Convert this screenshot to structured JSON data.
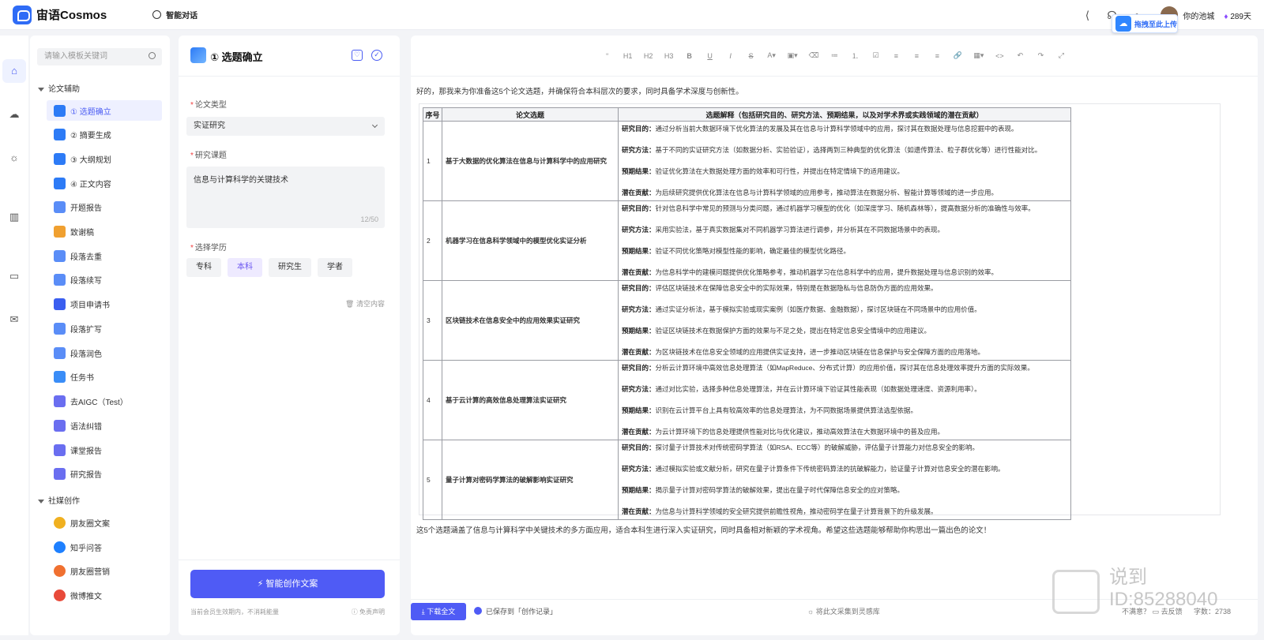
{
  "topbar": {
    "brand": "宙语Cosmos",
    "nav_label": "智能对话",
    "icons": [
      "share-icon",
      "headphones-icon",
      "bell-icon"
    ],
    "pool_label": "你的池城",
    "vip_label": "289天",
    "upload_badge": "拖拽至此上传"
  },
  "rail": {
    "items": [
      "home-icon",
      "cloud-icon",
      "bulb-icon",
      "book-icon",
      "monitor-icon",
      "inbox-icon"
    ]
  },
  "templates": {
    "search_placeholder": "请输入模板关键词",
    "groups": [
      {
        "label": "论文辅助",
        "items": [
          {
            "label": "① 选题确立",
            "active": true,
            "color": "#2d7bf6"
          },
          {
            "label": "② 摘要生成",
            "color": "#2d7bf6"
          },
          {
            "label": "③ 大纲规划",
            "color": "#2d7bf6"
          },
          {
            "label": "④ 正文内容",
            "color": "#2d7bf6"
          },
          {
            "label": "开题报告",
            "color": "#5a8df7"
          },
          {
            "label": "致谢稿",
            "color": "#f0a030"
          },
          {
            "label": "段落去重",
            "color": "#5a8df7"
          },
          {
            "label": "段落续写",
            "color": "#5a8df7"
          },
          {
            "label": "项目申请书",
            "color": "#3a5ef0"
          },
          {
            "label": "段落扩写",
            "color": "#5a8df7"
          },
          {
            "label": "段落润色",
            "color": "#5a8df7"
          },
          {
            "label": "任务书",
            "color": "#3a8df7"
          },
          {
            "label": "去AIGC（Test）",
            "color": "#6a6ef0"
          },
          {
            "label": "语法纠错",
            "color": "#6a6ef0"
          },
          {
            "label": "课堂报告",
            "color": "#6a6ef0"
          },
          {
            "label": "研究报告",
            "color": "#6a6ef0"
          }
        ]
      },
      {
        "label": "社媒创作",
        "items": [
          {
            "label": "朋友圈文案",
            "color": "#f0b020"
          },
          {
            "label": "知乎问答",
            "color": "#1e80ff"
          },
          {
            "label": "朋友圈营销",
            "color": "#f07030"
          },
          {
            "label": "微博推文",
            "color": "#e84a3a"
          }
        ]
      }
    ]
  },
  "form": {
    "title": "① 选题确立",
    "type_label": "论文类型",
    "type_value": "实证研究",
    "topic_label": "研究课题",
    "topic_value": "信息与计算科学的关键技术",
    "topic_count": "12/50",
    "edu_label": "选择学历",
    "edu_options": [
      "专科",
      "本科",
      "研究生",
      "学者"
    ],
    "edu_selected": "本科",
    "clear_label": "清空内容",
    "generate_label": "智能创作文案",
    "footer_left": "当前会员生效期内，不消耗能量",
    "footer_right": "免责声明"
  },
  "editor": {
    "toolbar": [
      "“",
      "H1",
      "H2",
      "H3",
      "B",
      "U",
      "I",
      "S",
      "A▾",
      "▣▾",
      "⌫",
      "≔",
      "⒈",
      "☑",
      "≡",
      "≡",
      "≡",
      "🔗",
      "▦▾",
      "<>",
      "↶",
      "↷",
      "⤢"
    ],
    "intro": "好的，那我来为你准备这5个论文选题，并确保符合本科层次的要求，同时具备学术深度与创新性。",
    "table_headers": [
      "序号",
      "论文选题",
      "选题解释（包括研究目的、研究方法、预期结果，以及对学术界或实践领域的潜在贡献）"
    ],
    "rows": [
      {
        "num": "1",
        "topic": "基于大数据的优化算法在信息与计算科学中的应用研究",
        "purpose": "通过分析当前大数据环境下优化算法的发展及其在信息与计算科学领域中的应用，探讨其在数据处理与信息挖掘中的表现。",
        "method": "基于不同的实证研究方法（如数据分析、实验验证），选择两到三种典型的优化算法（如遗传算法、粒子群优化等）进行性能对比。",
        "result": "验证优化算法在大数据处理方面的效率和可行性，并提出在特定情境下的适用建议。",
        "contrib": "为后续研究提供优化算法在信息与计算科学领域的应用参考，推动算法在数据分析、智能计算等领域的进一步应用。"
      },
      {
        "num": "2",
        "topic": "机器学习在信息科学领域中的模型优化实证分析",
        "purpose": "针对信息科学中常见的预测与分类问题，通过机器学习模型的优化（如深度学习、随机森林等），提高数据分析的准确性与效率。",
        "method": "采用实验法，基于真实数据集对不同机器学习算法进行调参，并分析其在不同数据场景中的表现。",
        "result": "验证不同优化策略对模型性能的影响，确定最佳的模型优化路径。",
        "contrib": "为信息科学中的建模问题提供优化策略参考，推动机器学习在信息科学中的应用，提升数据处理与信息识别的效率。"
      },
      {
        "num": "3",
        "topic": "区块链技术在信息安全中的应用效果实证研究",
        "purpose": "评估区块链技术在保障信息安全中的实际效果，特别是在数据隐私与信息防伪方面的应用效果。",
        "method": "通过实证分析法，基于模拟实验或现实案例（如医疗数据、金融数据），探讨区块链在不同场景中的应用价值。",
        "result": "验证区块链技术在数据保护方面的效果与不足之处，提出在特定信息安全情境中的应用建议。",
        "contrib": "为区块链技术在信息安全领域的应用提供实证支持，进一步推动区块链在信息保护与安全保障方面的应用落地。"
      },
      {
        "num": "4",
        "topic": "基于云计算的高效信息处理算法实证研究",
        "purpose": "分析云计算环境中高效信息处理算法（如MapReduce、分布式计算）的应用价值，探讨其在信息处理效率提升方面的实际效果。",
        "method": "通过对比实验，选择多种信息处理算法，并在云计算环境下验证其性能表现（如数据处理速度、资源利用率）。",
        "result": "识别在云计算平台上具有较高效率的信息处理算法，为不同数据场景提供算法选型依据。",
        "contrib": "为云计算环境下的信息处理提供性能对比与优化建议，推动高效算法在大数据环境中的普及应用。"
      },
      {
        "num": "5",
        "topic": "量子计算对密码学算法的破解影响实证研究",
        "purpose": "探讨量子计算技术对传统密码学算法（如RSA、ECC等）的破解威胁，评估量子计算能力对信息安全的影响。",
        "method": "通过模拟实验或文献分析，研究在量子计算条件下传统密码算法的抗破解能力，验证量子计算对信息安全的潜在影响。",
        "result": "揭示量子计算对密码学算法的破解效果，提出在量子时代保障信息安全的应对策略。",
        "contrib": "为信息与计算科学领域的安全研究提供前瞻性视角，推动密码学在量子计算背景下的升级发展。"
      }
    ],
    "labels": {
      "purpose": "研究目的：",
      "method": "研究方法：",
      "result": "预期结果：",
      "contrib": "潜在贡献："
    },
    "outro": "这5个选题涵盖了信息与计算科学中关键技术的多方面应用，适合本科生进行深入实证研究，同时具备相对新颖的学术视角。希望这些选题能够帮助你构思出一篇出色的论文！",
    "download_label": "下载全文",
    "saved_label": "已保存到「创作记录」",
    "collect_label": "将此文采集到灵感库",
    "feedback_q": "不满意？",
    "feedback_label": "去反馈",
    "word_count_label": "字数：",
    "word_count": "2738"
  },
  "watermark": {
    "line1": "说到",
    "line2": "ID:85288040"
  }
}
